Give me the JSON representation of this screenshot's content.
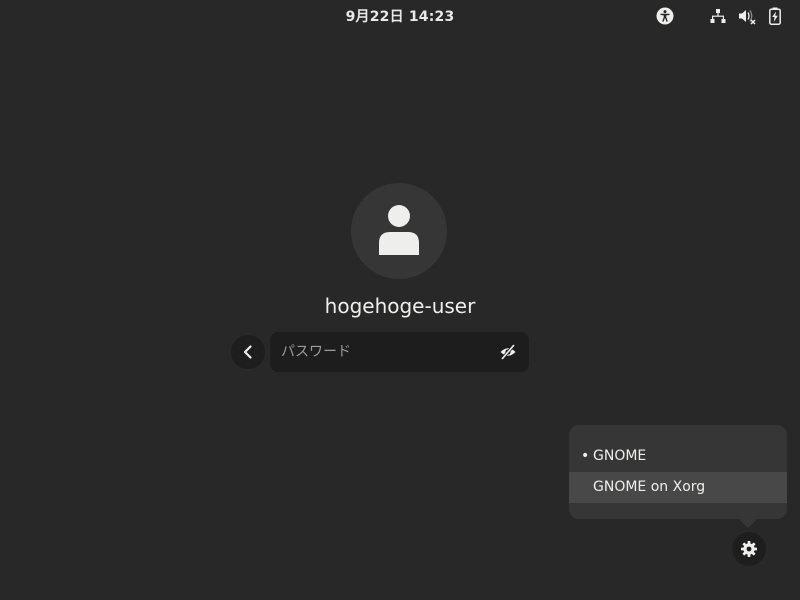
{
  "topbar": {
    "clock": "9月22日  14:23",
    "icons": [
      "accessibility-icon",
      "network-wired-icon",
      "volume-muted-icon",
      "battery-charging-icon"
    ]
  },
  "login": {
    "username": "hogehoge-user",
    "password_placeholder": "パスワード",
    "back_icon": "chevron-left-icon",
    "reveal_icon": "eye-hidden-icon",
    "avatar_icon": "user-icon"
  },
  "session_menu": {
    "items": [
      {
        "label": "GNOME",
        "selected": true,
        "marker": "•"
      },
      {
        "label": "GNOME on Xorg",
        "selected": false,
        "marker": ""
      }
    ],
    "settings_icon": "gear-icon"
  },
  "colors": {
    "background": "#282828",
    "entry": "#1d1d1d",
    "popover": "#363636",
    "hover": "#484848",
    "text": "#eeeeec"
  }
}
